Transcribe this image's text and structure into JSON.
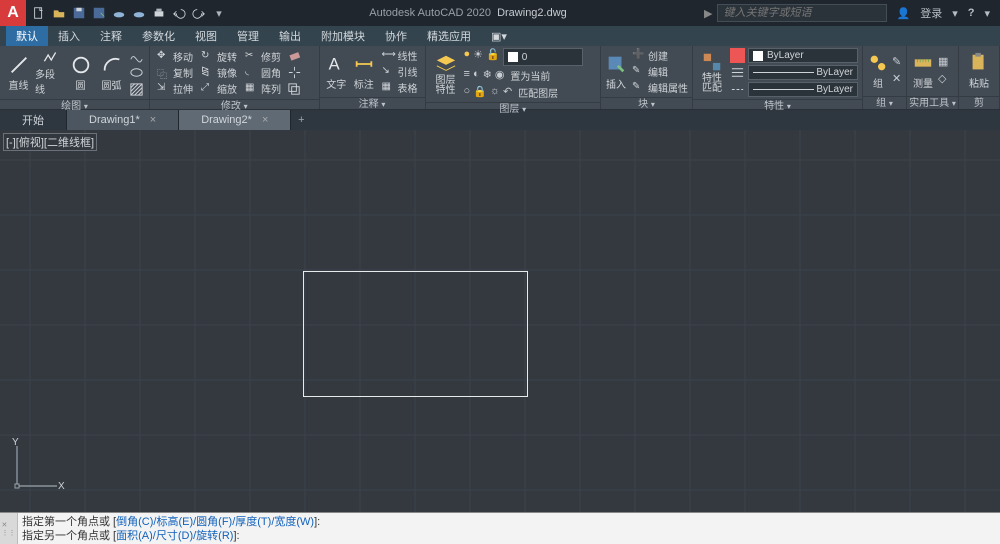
{
  "app": {
    "name": "Autodesk AutoCAD 2020",
    "current_doc": "Drawing2.dwg",
    "search_placeholder": "键入关键字或短语",
    "login_label": "登录"
  },
  "menus": [
    "默认",
    "插入",
    "注释",
    "参数化",
    "视图",
    "管理",
    "输出",
    "附加模块",
    "协作",
    "精选应用"
  ],
  "ribbon": {
    "draw": {
      "title": "绘图",
      "line": "直线",
      "polyline": "多段线",
      "circle": "圆",
      "arc": "圆弧"
    },
    "modify": {
      "title": "修改",
      "move": "移动",
      "rotate": "旋转",
      "trim": "修剪",
      "copy": "复制",
      "mirror": "镜像",
      "fillet": "圆角",
      "stretch": "拉伸",
      "scale": "缩放",
      "array": "阵列"
    },
    "annot": {
      "title": "注释",
      "text": "文字",
      "dim": "标注",
      "linear": "线性",
      "leader": "引线",
      "table": "表格"
    },
    "layers": {
      "title": "图层",
      "props": "图层\n特性",
      "current": "0",
      "make_current": "置为当前",
      "match": "匹配图层"
    },
    "insert": {
      "title": "块",
      "insert": "插入",
      "create": "创建",
      "edit": "编辑",
      "edit_attr": "编辑属性"
    },
    "props": {
      "title": "特性",
      "match": "特性\n匹配",
      "bylayer": "ByLayer"
    },
    "group": {
      "title": "组",
      "label": "组"
    },
    "util": {
      "title": "实用工具",
      "measure": "测量"
    },
    "clip": {
      "title": "剪",
      "paste": "粘贴"
    }
  },
  "doctabs": {
    "start": "开始",
    "tab1": "Drawing1*",
    "tab2": "Drawing2*"
  },
  "viewport_label": "[-][俯视][二维线框]",
  "ucs": {
    "x": "X",
    "y": "Y"
  },
  "cmd": {
    "line1_prefix": "指定第一个角点或 [",
    "line1_opts": "倒角(C)/标高(E)/圆角(F)/厚度(T)/宽度(W)",
    "line1_suffix": "]:",
    "line2_prefix": "指定另一个角点或 [",
    "line2_opts": "面积(A)/尺寸(D)/旋转(R)",
    "line2_suffix": "]:"
  }
}
